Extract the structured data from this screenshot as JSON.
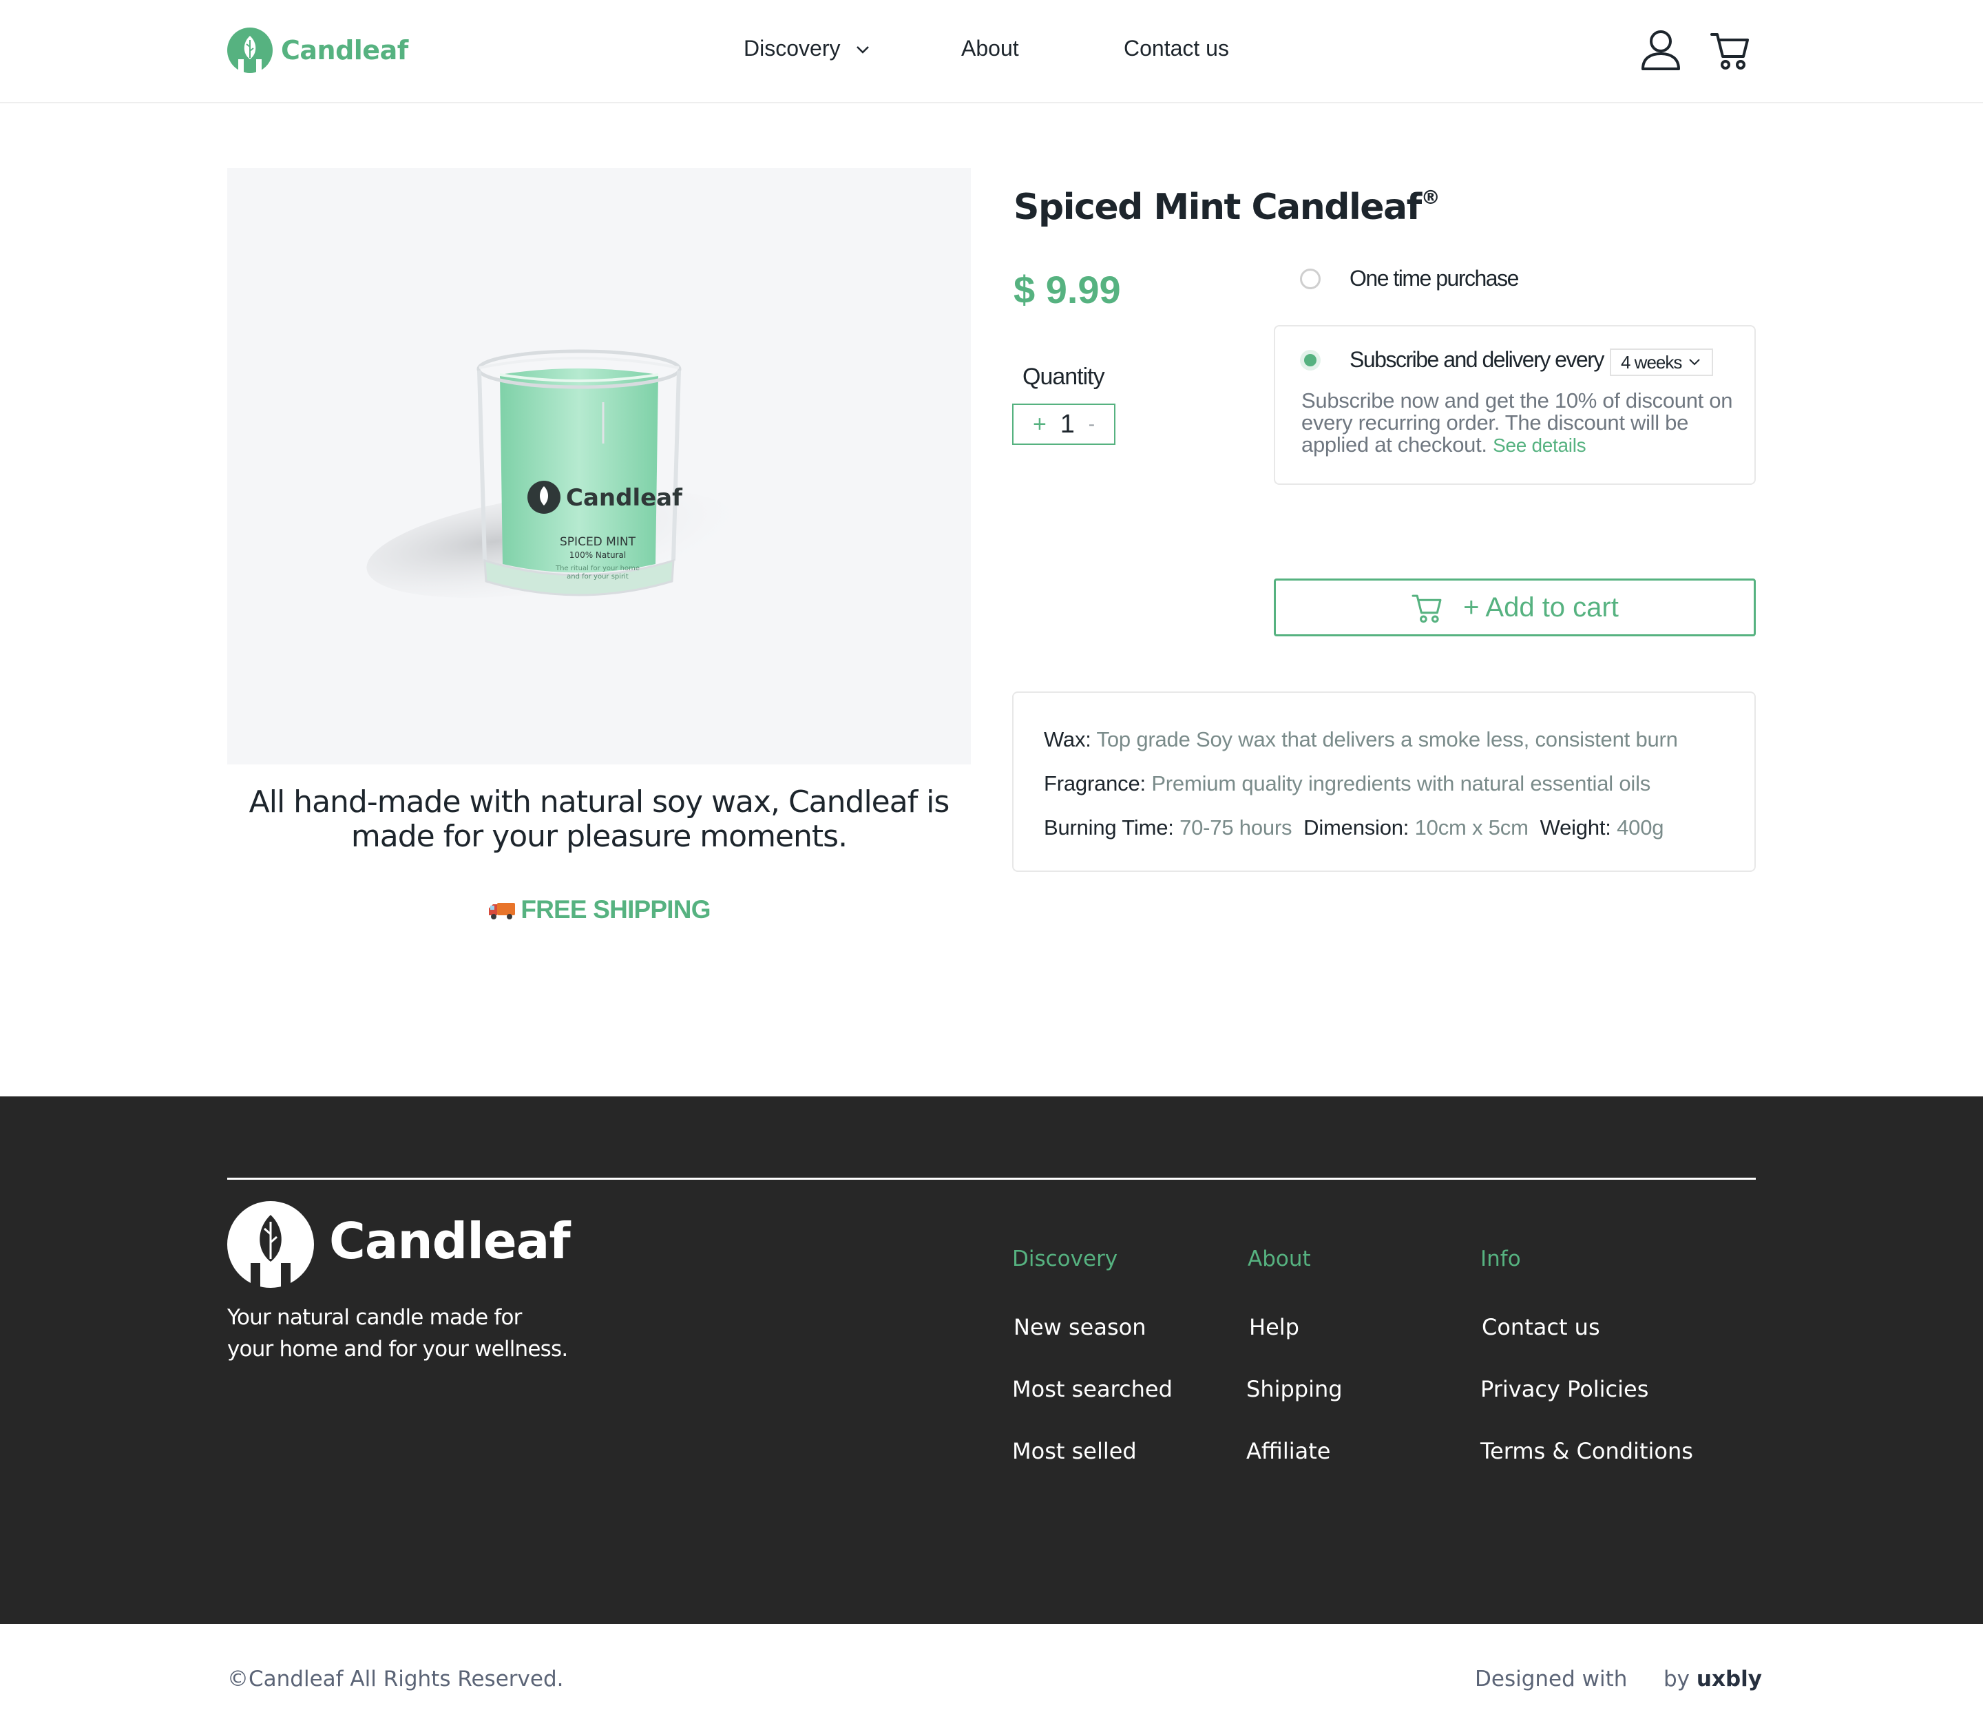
{
  "brand": {
    "name": "Candleaf",
    "accent_color": "#56b280",
    "dark_color": "#272727",
    "logo_icon": "leaf-candle-logo-icon"
  },
  "header": {
    "nav": {
      "discovery": "Discovery",
      "about": "About",
      "contact": "Contact us"
    },
    "icons": [
      "chevron-down-icon",
      "user-icon",
      "cart-icon"
    ]
  },
  "product": {
    "image_label": {
      "brand": "Candleaf",
      "name": "SPICED MINT",
      "natural": "100% Natural",
      "line1": "The ritual for your home",
      "line2": "and for your spirit"
    },
    "tagline_line1": "All hand-made with natural soy wax, Candleaf is",
    "tagline_line2": "made for your pleasure moments.",
    "shipping": "FREE SHIPPING",
    "title": "Spiced Mint Candleaf",
    "title_mark": "®",
    "price": "$ 9.99",
    "quantity_label": "Quantity",
    "quantity": {
      "plus": "+",
      "value": "1",
      "minus": "-"
    },
    "purchase_options": {
      "one_time": "One time purchase",
      "one_time_selected": false,
      "subscribe": "Subscribe and delivery every",
      "subscribe_selected": true,
      "interval": "4 weeks",
      "description": "Subscribe now and get the 10% of discount on every recurring order.  The discount will be applied at checkout.",
      "see_details": "See details"
    },
    "add_to_cart": "+ Add to cart",
    "specs": {
      "wax_label": "Wax:",
      "wax": "Top grade Soy wax that delivers a smoke less,  consistent burn",
      "fragrance_label": "Fragrance:",
      "fragrance": "Premium quality ingredients with natural essential oils",
      "burning_label": "Burning Time:",
      "burning": "70-75 hours",
      "dimension_label": "Dimension:",
      "dimension": "10cm x 5cm",
      "weight_label": "Weight:",
      "weight": "400g"
    }
  },
  "footer": {
    "brand": "Candleaf",
    "tagline_line1": "Your natural candle made for",
    "tagline_line2": "your home and for your wellness.",
    "columns": [
      {
        "heading": "Discovery",
        "links": [
          "New season",
          "Most searched",
          "Most selled"
        ]
      },
      {
        "heading": "About",
        "links": [
          "Help",
          "Shipping",
          "Affiliate"
        ]
      },
      {
        "heading": "Info",
        "links": [
          "Contact us",
          "Privacy Policies",
          "Terms & Conditions"
        ]
      }
    ],
    "copyright": "©Candleaf All Rights Reserved.",
    "designed_with": "Designed with",
    "by": "by",
    "designer": "uxbly"
  }
}
